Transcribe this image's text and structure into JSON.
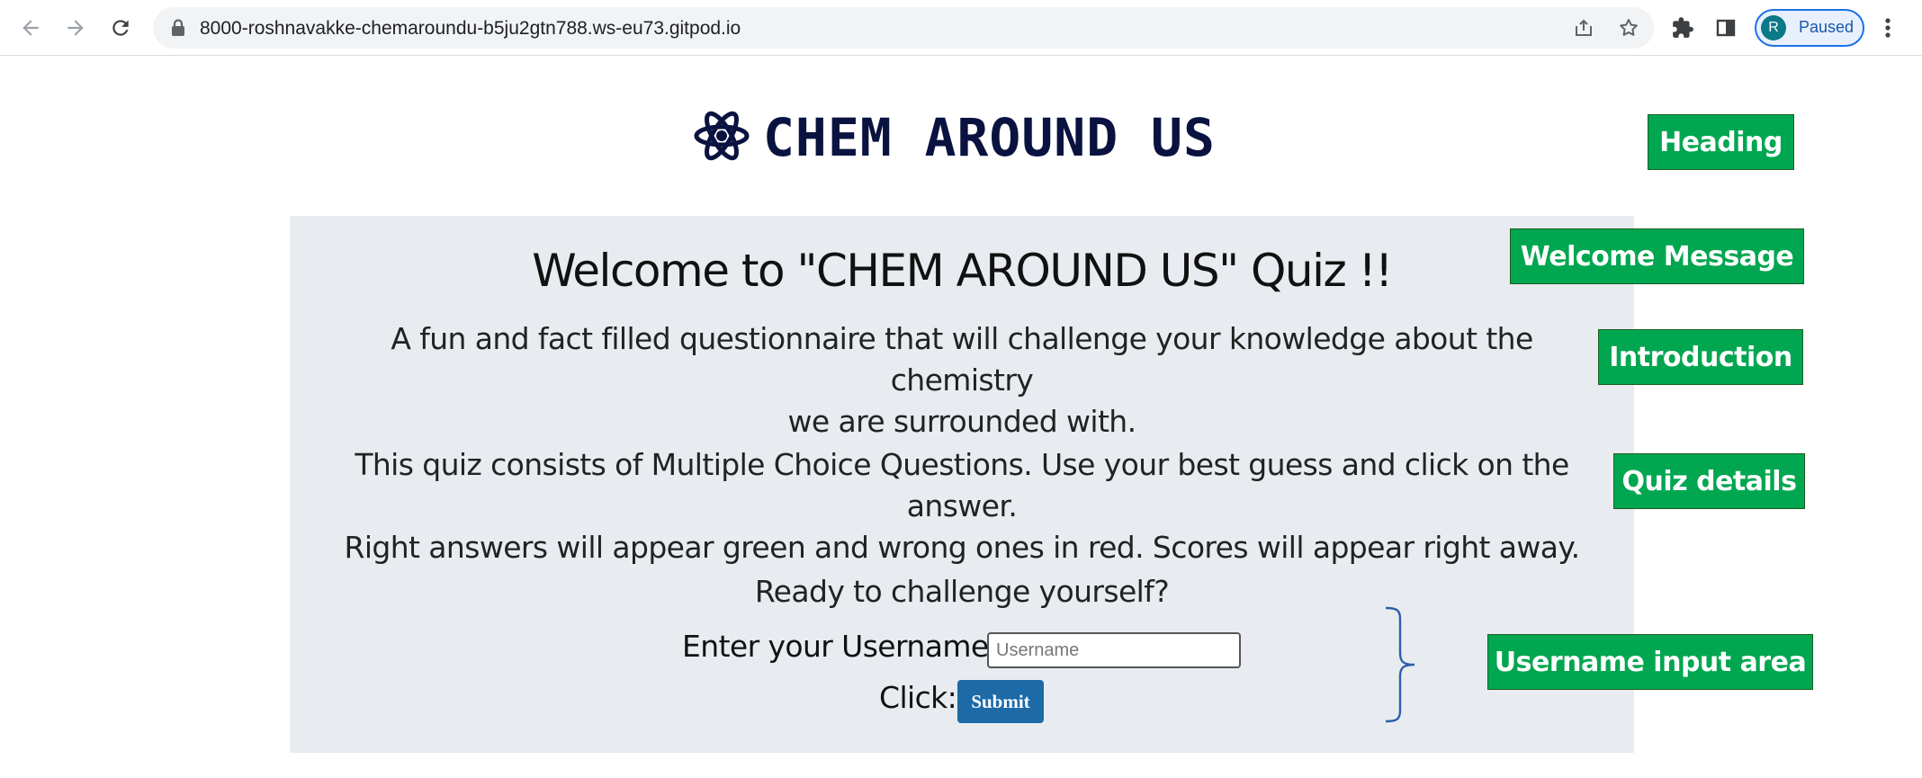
{
  "browser": {
    "url": "8000-roshnavakke-chemaroundu-b5ju2gtn788.ws-eu73.gitpod.io",
    "profile_initial": "R",
    "profile_status": "Paused"
  },
  "page": {
    "brand_title": "CHEM AROUND US",
    "welcome_heading": "Welcome to \"CHEM AROUND US\" Quiz !!",
    "intro_line1": "A fun and fact filled questionnaire that will challenge your knowledge about the chemistry",
    "intro_line2": "we are surrounded with.",
    "details_line1": "This quiz consists of Multiple Choice Questions. Use your best guess and click on the answer.",
    "details_line2": "Right answers will appear green and wrong ones in red. Scores will appear right away.",
    "ready_text": "Ready to challenge yourself?",
    "username_label": "Enter your Username:",
    "username_placeholder": "Username",
    "click_label": "Click:",
    "submit_label": "Submit"
  },
  "annotations": {
    "heading": "Heading",
    "welcome": "Welcome Message",
    "introduction": "Introduction",
    "quiz_details": "Quiz details",
    "username_area": "Username input area"
  },
  "colors": {
    "annotation_bg": "#00a650",
    "brand_text": "#0a1240",
    "panel_bg": "#e8ecf0",
    "submit_bg": "#1d6aa7",
    "brace": "#2e5fa8"
  },
  "icons": [
    "back-arrow-icon",
    "forward-arrow-icon",
    "reload-icon",
    "lock-icon",
    "share-icon",
    "star-icon",
    "extensions-icon",
    "side-panel-icon",
    "kebab-menu-icon",
    "atom-icon"
  ]
}
